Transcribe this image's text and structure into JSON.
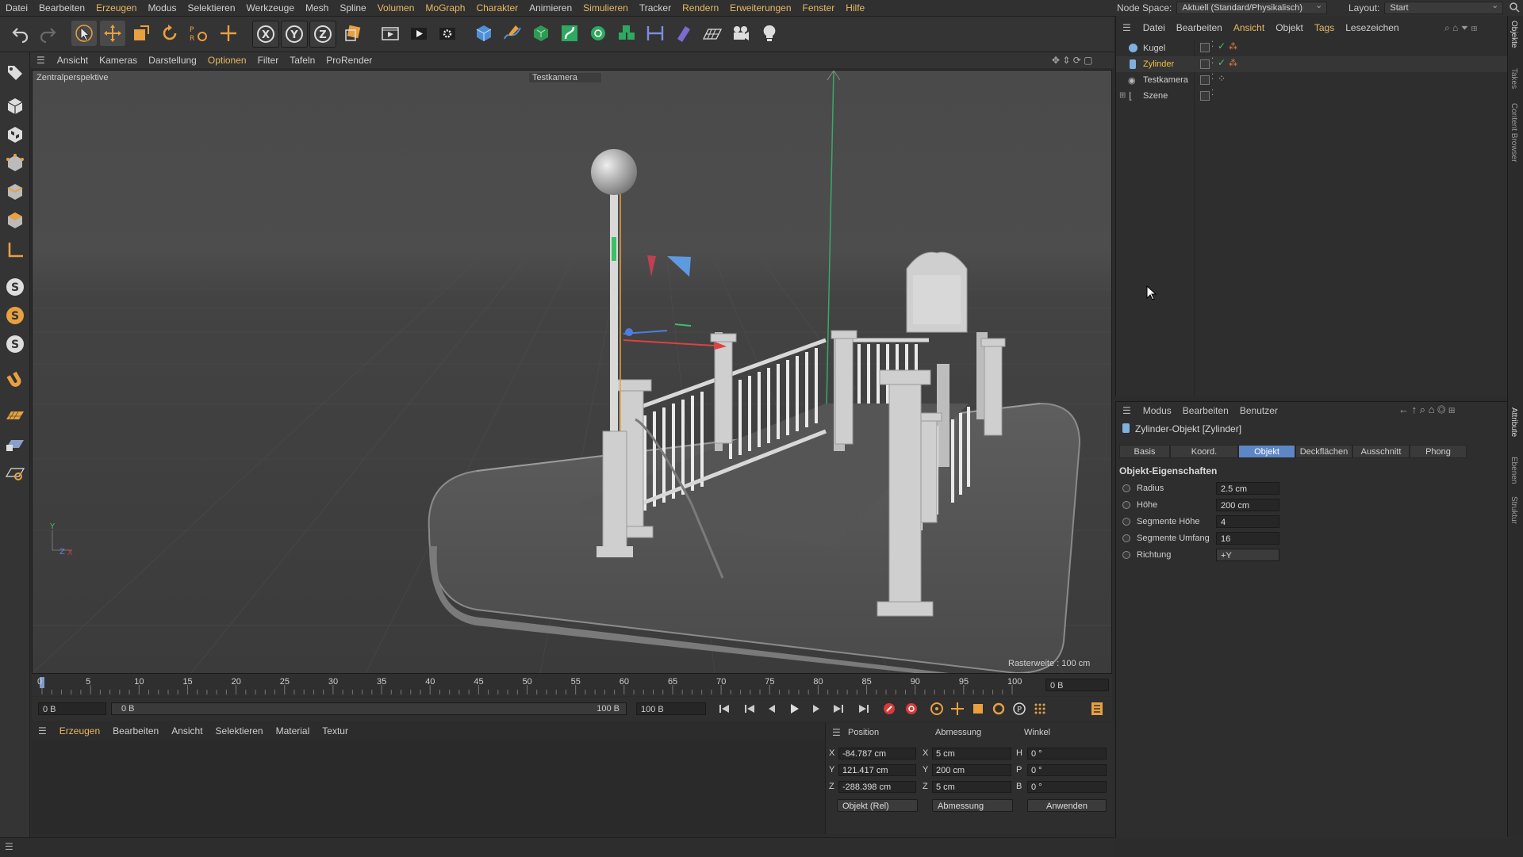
{
  "menubar": {
    "items": [
      "Datei",
      "Bearbeiten",
      "Erzeugen",
      "Modus",
      "Selektieren",
      "Werkzeuge",
      "Mesh",
      "Spline",
      "Volumen",
      "MoGraph",
      "Charakter",
      "Animieren",
      "Simulieren",
      "Tracker",
      "Rendern",
      "Erweiterungen",
      "Fenster",
      "Hilfe"
    ],
    "node_space_label": "Node Space:",
    "node_space_value": "Aktuell (Standard/Physikalisch)",
    "layout_label": "Layout:",
    "layout_value": "Start"
  },
  "toolbar": {
    "icons": [
      "undo-icon",
      "redo-icon",
      "select-icon",
      "move-icon",
      "scale-icon",
      "rotate-icon",
      "recent-tools-icon",
      "world-axis-icon",
      "x-axis-lock-icon",
      "y-axis-lock-icon",
      "z-axis-lock-icon",
      "coordinate-system-icon",
      "render-region-icon",
      "render-view-icon",
      "render-settings-icon",
      "cube-primitive-icon",
      "pen-spline-icon",
      "subdivision-icon",
      "bend-deformer-icon",
      "cloner-icon",
      "array-icon",
      "symmetry-icon",
      "deformer-icon",
      "floor-icon",
      "camera-icon",
      "light-icon"
    ],
    "axis_letters": [
      "X",
      "Y",
      "Z"
    ]
  },
  "leftbar": {
    "icons": [
      "make-editable-icon",
      "model-mode-icon",
      "texture-mode-icon",
      "points-mode-icon",
      "edges-mode-icon",
      "polygons-mode-icon",
      "axis-mode-icon",
      "snap-icon",
      "solo-icon",
      "solo-selection-icon",
      "magnet-icon",
      "workplane-icon",
      "locked-workplane-icon",
      "grid-snap-icon"
    ],
    "s_letter": "S"
  },
  "viewport": {
    "menu": [
      "Ansicht",
      "Kameras",
      "Darstellung",
      "Optionen",
      "Filter",
      "Tafeln",
      "ProRender"
    ],
    "active_menu": "Optionen",
    "perspective_label": "Zentralperspektive",
    "camera_label": "Testkamera",
    "grid_spacing": "Rasterweite : 100 cm",
    "axis_x": "X",
    "axis_y": "Y",
    "axis_z": "Z"
  },
  "timeline": {
    "ticks": [
      "0",
      "5",
      "10",
      "15",
      "20",
      "25",
      "30",
      "35",
      "40",
      "45",
      "50",
      "55",
      "60",
      "65",
      "70",
      "75",
      "80",
      "85",
      "90",
      "95",
      "100"
    ],
    "current_frame": "0 B",
    "start_frame": "0 B",
    "range_start": "0 B",
    "range_end": "100 B",
    "end_frame": "100 B"
  },
  "material_manager": {
    "menu": [
      "Erzeugen",
      "Bearbeiten",
      "Ansicht",
      "Selektieren",
      "Material",
      "Textur"
    ],
    "active_menu": "Erzeugen"
  },
  "coordinates": {
    "headers": [
      "Position",
      "Abmessung",
      "Winkel"
    ],
    "rows": [
      {
        "axis": "X",
        "position": "-84.787 cm",
        "size_axis": "X",
        "size": "5 cm",
        "angle_axis": "H",
        "angle": "0 °"
      },
      {
        "axis": "Y",
        "position": "121.417 cm",
        "size_axis": "Y",
        "size": "200 cm",
        "angle_axis": "P",
        "angle": "0 °"
      },
      {
        "axis": "Z",
        "position": "-288.398 cm",
        "size_axis": "Z",
        "size": "5 cm",
        "angle_axis": "B",
        "angle": "0 °"
      }
    ],
    "mode_dropdown": "Objekt (Rel)",
    "size_dropdown": "Abmessung",
    "apply_button": "Anwenden"
  },
  "object_manager": {
    "menu": [
      "Datei",
      "Bearbeiten",
      "Ansicht",
      "Objekt",
      "Tags",
      "Lesezeichen"
    ],
    "active_menu": "Ansicht",
    "objects": [
      {
        "name": "Kugel",
        "selected": false
      },
      {
        "name": "Zylinder",
        "selected": true
      },
      {
        "name": "Testkamera",
        "selected": false
      },
      {
        "name": "Szene",
        "selected": false
      }
    ]
  },
  "attributes": {
    "menu": [
      "Modus",
      "Bearbeiten",
      "Benutzer"
    ],
    "object_title": "Zylinder-Objekt [Zylinder]",
    "tabs": [
      "Basis",
      "Koord.",
      "Objekt",
      "Deckflächen",
      "Ausschnitt",
      "Phong"
    ],
    "active_tab": "Objekt",
    "section_title": "Objekt-Eigenschaften",
    "properties": [
      {
        "label": "Radius",
        "value": "2.5 cm"
      },
      {
        "label": "Höhe",
        "value": "200 cm"
      },
      {
        "label": "Segmente Höhe",
        "value": "4"
      },
      {
        "label": "Segmente Umfang",
        "value": "16"
      },
      {
        "label": "Richtung",
        "value": "+Y"
      }
    ]
  },
  "side_tabs": [
    "Objekte",
    "Takes",
    "Content Browser",
    "Attribute",
    "Ebenen",
    "Struktur"
  ],
  "colors": {
    "accent": "#e8b860",
    "selection": "#f0c040",
    "active_tab": "#5c87c4"
  }
}
